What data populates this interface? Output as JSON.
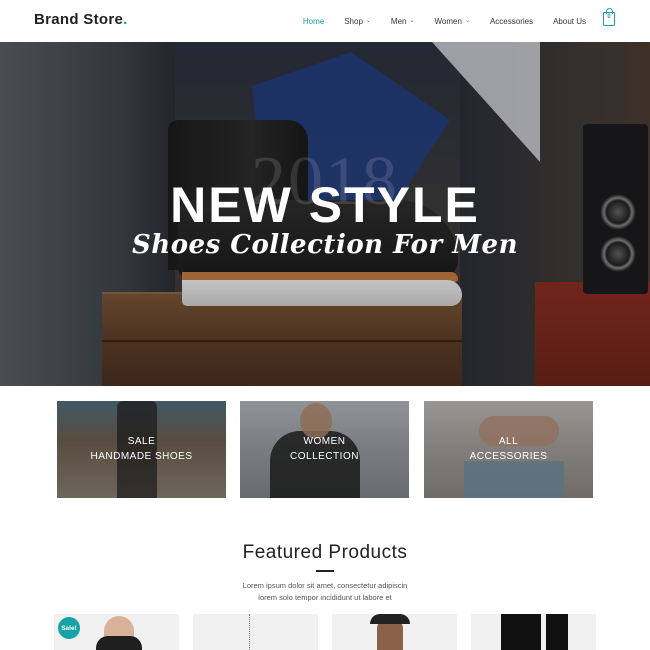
{
  "brand": {
    "name": "Brand Store",
    "dot": "."
  },
  "nav": {
    "items": [
      {
        "label": "Home",
        "active": true,
        "dropdown": false
      },
      {
        "label": "Shop",
        "active": false,
        "dropdown": true
      },
      {
        "label": "Men",
        "active": false,
        "dropdown": true
      },
      {
        "label": "Women",
        "active": false,
        "dropdown": true
      },
      {
        "label": "Accessories",
        "active": false,
        "dropdown": false
      },
      {
        "label": "About Us",
        "active": false,
        "dropdown": false
      }
    ],
    "cart_count": "0"
  },
  "hero": {
    "year": "2018",
    "title": "NEW STYLE",
    "subtitle": "Shoes Collection For Men"
  },
  "categories": [
    {
      "line1": "SALE",
      "line2": "HANDMADE SHOES"
    },
    {
      "line1": "WOMEN",
      "line2": "COLLECTION"
    },
    {
      "line1": "ALL",
      "line2": "ACCESSORIES"
    }
  ],
  "featured": {
    "title": "Featured Products",
    "desc_line1": "Lorem ipsum dolor sit amet, consectetur adipiscin",
    "desc_line2": "lorem solo tempor incididunt ut labore et",
    "sale_badge": "Sale!"
  },
  "colors": {
    "accent": "#17a2a7",
    "text": "#222222"
  },
  "icons": {
    "cart": "shopping-bag-icon",
    "chevron": "chevron-down-icon"
  }
}
